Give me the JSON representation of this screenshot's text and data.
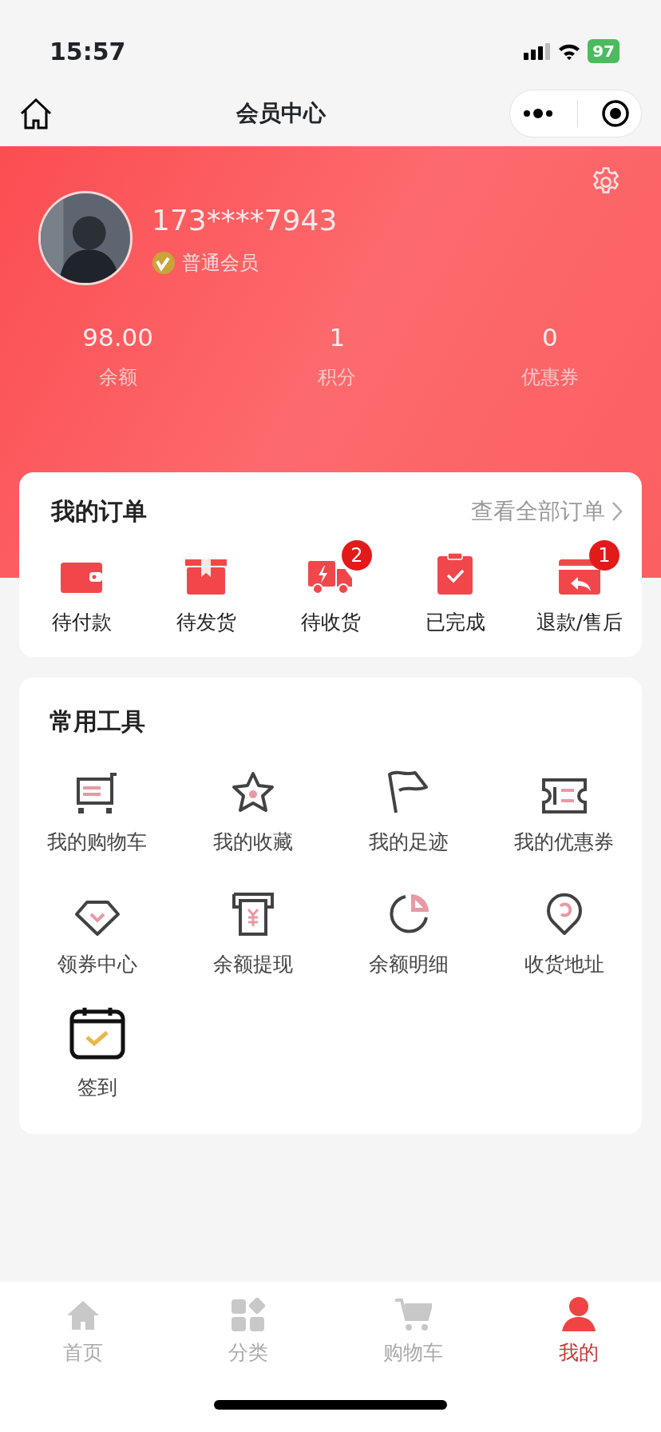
{
  "status_bar": {
    "time": "15:57",
    "battery": "97"
  },
  "nav": {
    "title": "会员中心"
  },
  "profile": {
    "phone": "173****7943",
    "level": "普通会员"
  },
  "stats": [
    {
      "value": "98.00",
      "label": "余额"
    },
    {
      "value": "1",
      "label": "积分"
    },
    {
      "value": "0",
      "label": "优惠券"
    }
  ],
  "orders": {
    "title": "我的订单",
    "link": "查看全部订单",
    "items": [
      {
        "label": "待付款"
      },
      {
        "label": "待发货"
      },
      {
        "label": "待收货",
        "badge": "2"
      },
      {
        "label": "已完成"
      },
      {
        "label": "退款/售后",
        "badge": "1"
      }
    ]
  },
  "tools": {
    "title": "常用工具",
    "items": [
      {
        "label": "我的购物车"
      },
      {
        "label": "我的收藏"
      },
      {
        "label": "我的足迹"
      },
      {
        "label": "我的优惠券"
      },
      {
        "label": "领券中心"
      },
      {
        "label": "余额提现"
      },
      {
        "label": "余额明细"
      },
      {
        "label": "收货地址"
      },
      {
        "label": "签到"
      }
    ]
  },
  "tab_bar": [
    {
      "label": "首页",
      "selected": false
    },
    {
      "label": "分类",
      "selected": false
    },
    {
      "label": "购物车",
      "selected": false
    },
    {
      "label": "我的",
      "selected": true
    }
  ]
}
